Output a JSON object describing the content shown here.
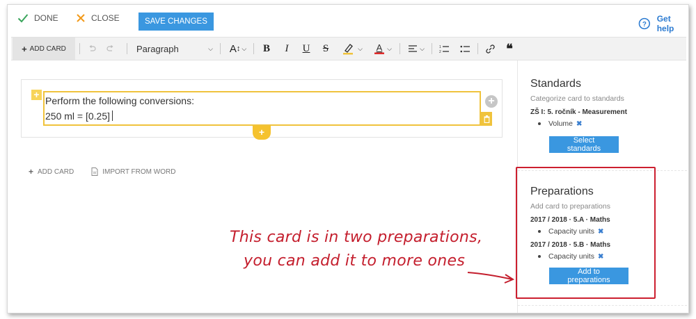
{
  "topbar": {
    "done_label": "DONE",
    "close_label": "CLOSE",
    "save_label": "SAVE CHANGES",
    "help_label": "Get help"
  },
  "toolbar": {
    "add_card_label": "ADD CARD",
    "paragraph_select": "Paragraph",
    "font_size_label": "A",
    "bold": "B",
    "italic": "I",
    "underline": "U",
    "strike": "S"
  },
  "card": {
    "line1": "Perform the following conversions:",
    "line2": "250 ml = [0.25]"
  },
  "bottom_actions": {
    "add_card": "ADD CARD",
    "import_word": "IMPORT FROM WORD"
  },
  "standards": {
    "title": "Standards",
    "subtitle": "Categorize card to standards",
    "group": "ZŠ I: 5. ročník - Measurement",
    "items": [
      "Volume"
    ],
    "button": "Select standards"
  },
  "preparations": {
    "title": "Preparations",
    "subtitle": "Add card to preparations",
    "groups": [
      {
        "name": "2017 / 2018 · 5.A · Maths",
        "items": [
          "Capacity units"
        ]
      },
      {
        "name": "2017 / 2018 · 5.B · Maths",
        "items": [
          "Capacity units"
        ]
      }
    ],
    "button": "Add to preparations"
  },
  "annotation": {
    "line1": "This card is in two preparations,",
    "line2": "you can add it to more ones"
  },
  "colors": {
    "accent_blue": "#3a97e0",
    "highlight_yellow": "#f0c33c",
    "annotation_red": "#cc1f2f",
    "done_green": "#3aa55b",
    "close_orange": "#f29a1a"
  }
}
